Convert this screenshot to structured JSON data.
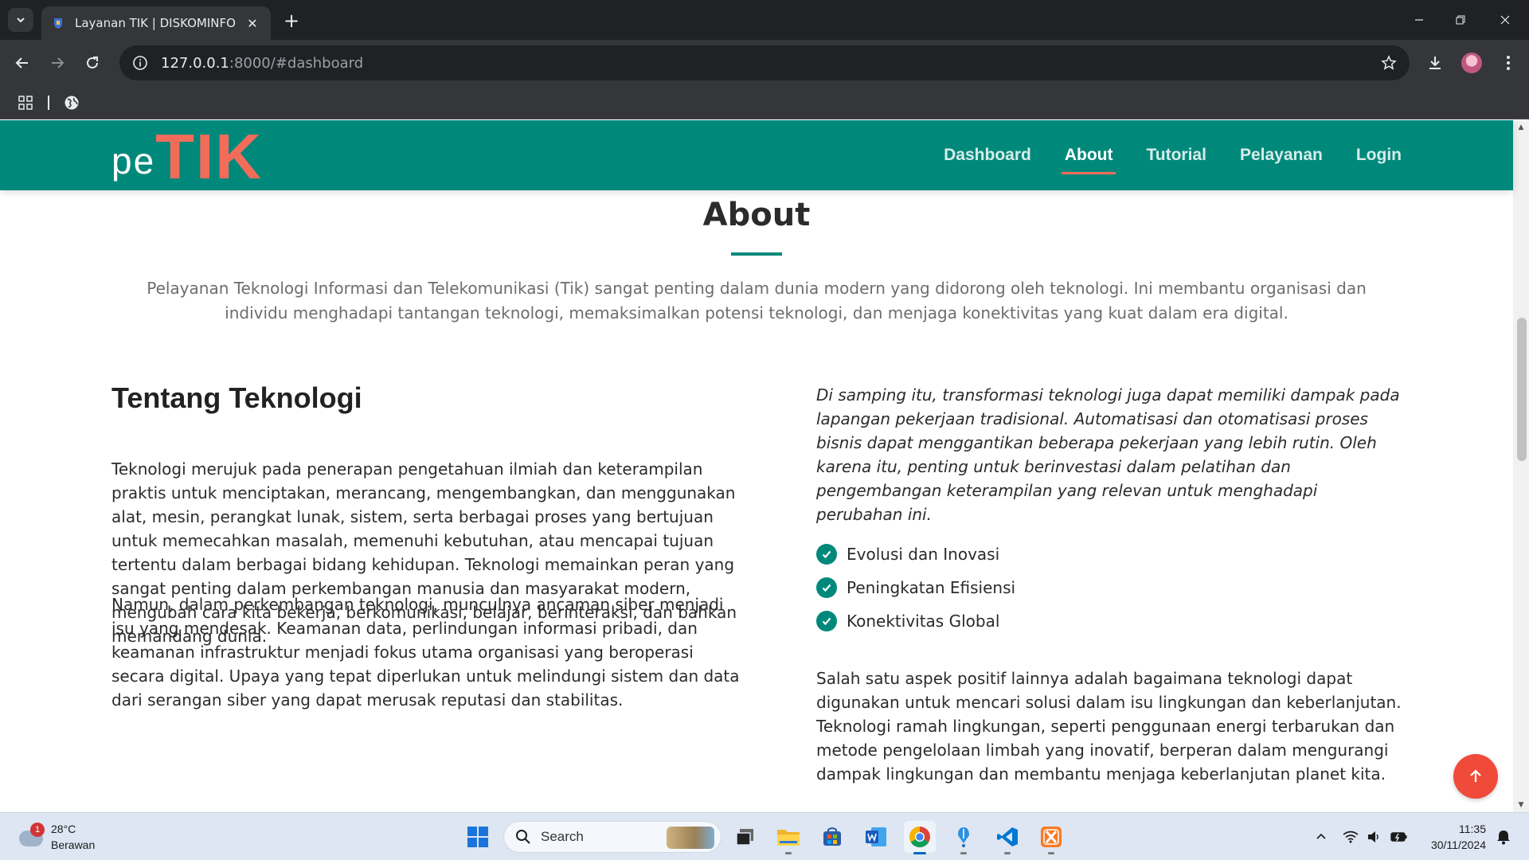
{
  "browser": {
    "tab_title": "Layanan TIK | DISKOMINFO",
    "url_host": "127.0.0.1",
    "url_rest": ":8000/#dashboard"
  },
  "site": {
    "logo_pe": "pe",
    "logo_tik": "TIK",
    "nav": [
      {
        "label": "Dashboard",
        "active": false
      },
      {
        "label": "About",
        "active": true
      },
      {
        "label": "Tutorial",
        "active": false
      },
      {
        "label": "Pelayanan",
        "active": false
      },
      {
        "label": "Login",
        "active": false
      }
    ],
    "accent": "#00897b",
    "logo_color": "#f26c5a"
  },
  "about": {
    "title": "About",
    "intro": "Pelayanan Teknologi Informasi dan Telekomunikasi (Tik) sangat penting dalam dunia modern yang didorong oleh teknologi. Ini membantu organisasi dan individu menghadapi tantangan teknologi, memaksimalkan potensi teknologi, dan menjaga konektivitas yang kuat dalam era digital.",
    "left_heading": "Tentang Teknologi",
    "left_p1": "Teknologi merujuk pada penerapan pengetahuan ilmiah dan keterampilan praktis untuk menciptakan, merancang, mengembangkan, dan menggunakan alat, mesin, perangkat lunak, sistem, serta berbagai proses yang bertujuan untuk memecahkan masalah, memenuhi kebutuhan, atau mencapai tujuan tertentu dalam berbagai bidang kehidupan. Teknologi memainkan peran yang sangat penting dalam perkembangan manusia dan masyarakat modern, mengubah cara kita bekerja, berkomunikasi, belajar, berinteraksi, dan bahkan memandang dunia.",
    "left_p2": "Namun, dalam perkembangan teknologi, munculnya ancaman siber menjadi isu yang mendesak. Keamanan data, perlindungan informasi pribadi, dan keamanan infrastruktur menjadi fokus utama organisasi yang beroperasi secara digital. Upaya yang tepat diperlukan untuk melindungi sistem dan data dari serangan siber yang dapat merusak reputasi dan stabilitas.",
    "right_italic": "Di samping itu, transformasi teknologi juga dapat memiliki dampak pada lapangan pekerjaan tradisional. Automatisasi dan otomatisasi proses bisnis dapat menggantikan beberapa pekerjaan yang lebih rutin. Oleh karena itu, penting untuk berinvestasi dalam pelatihan dan pengembangan keterampilan yang relevan untuk menghadapi perubahan ini.",
    "checklist": [
      "Evolusi dan Inovasi",
      "Peningkatan Efisiensi",
      "Konektivitas Global"
    ],
    "right_p3": "Salah satu aspek positif lainnya adalah bagaimana teknologi dapat digunakan untuk mencari solusi dalam isu lingkungan dan keberlanjutan. Teknologi ramah lingkungan, seperti penggunaan energi terbarukan dan metode pengelolaan limbah yang inovatif, berperan dalam mengurangi dampak lingkungan dan membantu menjaga keberlanjutan planet kita."
  },
  "taskbar": {
    "weather_badge": "1",
    "weather_temp": "28°C",
    "weather_cond": "Berawan",
    "search_label": "Search",
    "time": "11:35",
    "date": "30/11/2024"
  }
}
